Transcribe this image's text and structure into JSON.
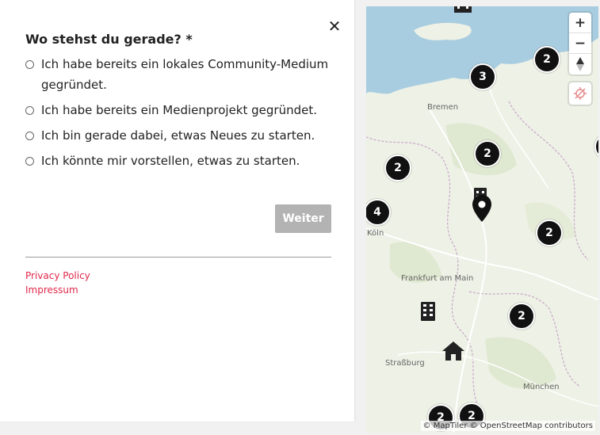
{
  "form": {
    "question": "Wo stehst du gerade? *",
    "options": [
      {
        "label": "Ich habe bereits ein lokales Community-Medium gegründet."
      },
      {
        "label": "Ich habe bereits ein Medienprojekt gegründet."
      },
      {
        "label": "Ich bin gerade dabei, etwas Neues zu starten."
      },
      {
        "label": "Ich könnte mir vorstellen, etwas zu starten."
      }
    ],
    "next_label": "Weiter",
    "close_glyph": "✕"
  },
  "footer": {
    "privacy": "Privacy Policy",
    "imprint": "Impressum"
  },
  "map": {
    "zoom_in": "+",
    "zoom_out": "−",
    "attribution": "© MapTiler © OpenStreetMap contributors",
    "cities": [
      "Bremen",
      "Köln",
      "Frankfurt am Main",
      "Straßburg",
      "München"
    ],
    "clusters": [
      "3",
      "2",
      "2",
      "2",
      "4",
      "2",
      "2",
      "2",
      "2"
    ],
    "icons": [
      "compass-icon",
      "location-off-icon",
      "pin-icon",
      "building-icon",
      "home-icon"
    ]
  },
  "colors": {
    "link": "#e0284a",
    "button_disabled": "#b3b3b3",
    "cluster": "#111111",
    "water": "#a9cde0",
    "land": "#eef1e6"
  }
}
